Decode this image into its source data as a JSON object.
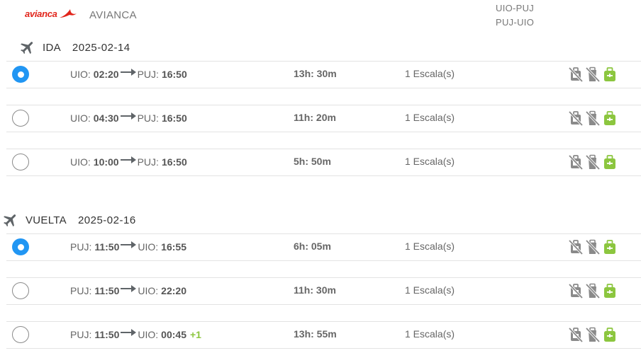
{
  "header": {
    "logo_text": "avianca",
    "airline_name": "AVIANCA",
    "routes": [
      "UIO-PUJ",
      "PUJ-UIO"
    ]
  },
  "sections": [
    {
      "label": "IDA",
      "date": "2025-02-14",
      "flights": [
        {
          "selected": true,
          "origin": "UIO:",
          "dep": "02:20",
          "dest": "PUJ:",
          "arr": "16:50",
          "plus": "",
          "duration": "13h: 30m",
          "stops": "1 Escala(s)"
        },
        {
          "selected": false,
          "origin": "UIO:",
          "dep": "04:30",
          "dest": "PUJ:",
          "arr": "16:50",
          "plus": "",
          "duration": "11h: 20m",
          "stops": "1 Escala(s)"
        },
        {
          "selected": false,
          "origin": "UIO:",
          "dep": "10:00",
          "dest": "PUJ:",
          "arr": "16:50",
          "plus": "",
          "duration": "5h: 50m",
          "stops": "1 Escala(s)"
        }
      ]
    },
    {
      "label": "VUELTA",
      "date": "2025-02-16",
      "flights": [
        {
          "selected": true,
          "origin": "PUJ:",
          "dep": "11:50",
          "dest": "UIO:",
          "arr": "16:55",
          "plus": "",
          "duration": "6h: 05m",
          "stops": "1 Escala(s)"
        },
        {
          "selected": false,
          "origin": "PUJ:",
          "dep": "11:50",
          "dest": "UIO:",
          "arr": "22:20",
          "plus": "",
          "duration": "11h: 30m",
          "stops": "1 Escala(s)"
        },
        {
          "selected": false,
          "origin": "PUJ:",
          "dep": "11:50",
          "dest": "UIO:",
          "arr": "00:45",
          "plus": "+1",
          "duration": "13h: 55m",
          "stops": "1 Escala(s)"
        }
      ]
    }
  ],
  "icons": {
    "section": "airplane-icon",
    "arrow": "arrow-right-icon",
    "baggage": [
      "no-checked-bag-icon",
      "no-personal-bag-icon",
      "carry-on-bag-icon"
    ]
  },
  "colors": {
    "brand": "#e1251b",
    "radio_selected": "#2196f3",
    "carry_on": "#8cc63f",
    "disabled_icon": "#8a8a8a"
  }
}
